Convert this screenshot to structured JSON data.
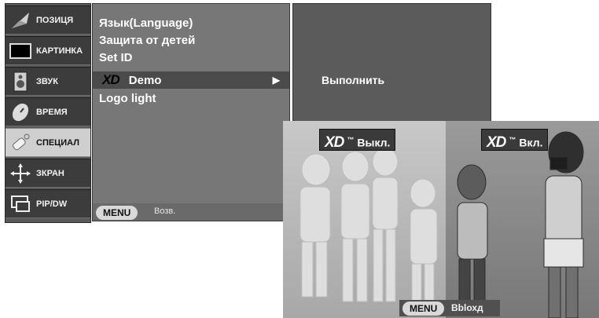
{
  "sidebar": {
    "items": [
      {
        "label": "ПОЗИЦЯ",
        "icon": "position-icon"
      },
      {
        "label": "КАРТИНКА",
        "icon": "picture-icon"
      },
      {
        "label": "ЗВУК",
        "icon": "speaker-icon"
      },
      {
        "label": "ВРЕМЯ",
        "icon": "clock-icon"
      },
      {
        "label": "СПЕЦИАЛ",
        "icon": "special-icon",
        "active": true
      },
      {
        "label": "ЗКРАН",
        "icon": "screen-icon"
      },
      {
        "label": "PIP/DW",
        "icon": "pip-icon"
      }
    ]
  },
  "submenu": {
    "items": [
      "Язык(Language)",
      "Защита от детей",
      "Set ID",
      "Demo",
      "Logo light"
    ],
    "selected_logo": "XD",
    "arrow": "▶",
    "menu_button": "MENU",
    "back_label": "Возв."
  },
  "right_panel": {
    "action": "Выполнить"
  },
  "demo": {
    "left_badge_logo": "XD",
    "left_badge_tm": "™",
    "left_badge_label": "Выкл.",
    "right_badge_logo": "XD",
    "right_badge_tm": "™",
    "right_badge_label": "Вкл.",
    "menu_button": "MENU",
    "exit_label": "Вblохд"
  },
  "colors": {
    "osd_dark": "#3c3c3c",
    "osd_mid": "#777777",
    "osd_active": "#cfcfcf"
  }
}
